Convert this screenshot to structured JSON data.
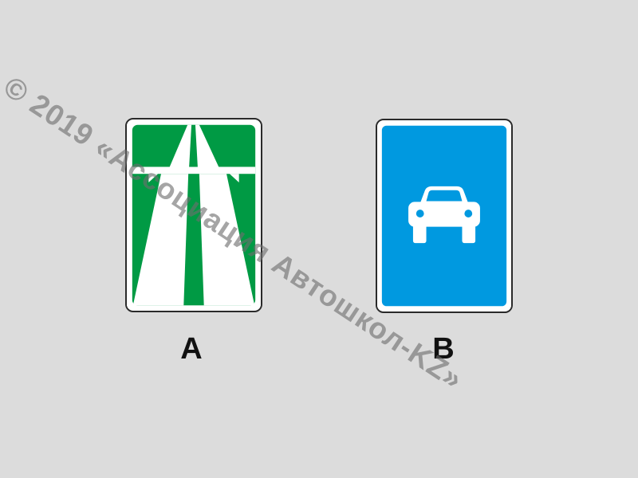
{
  "signs": [
    {
      "label": "A",
      "icon": "motorway-sign-icon",
      "background_color": "#009a44"
    },
    {
      "label": "B",
      "icon": "car-road-sign-icon",
      "background_color": "#0099e0"
    }
  ],
  "watermark": {
    "text": "© 2019 «Ассоциация Автошкол-KZ»",
    "color": "#6e6e6e"
  },
  "colors": {
    "page_background": "#dcdcdc",
    "sign_white": "#ffffff",
    "caption_text": "#111111"
  }
}
